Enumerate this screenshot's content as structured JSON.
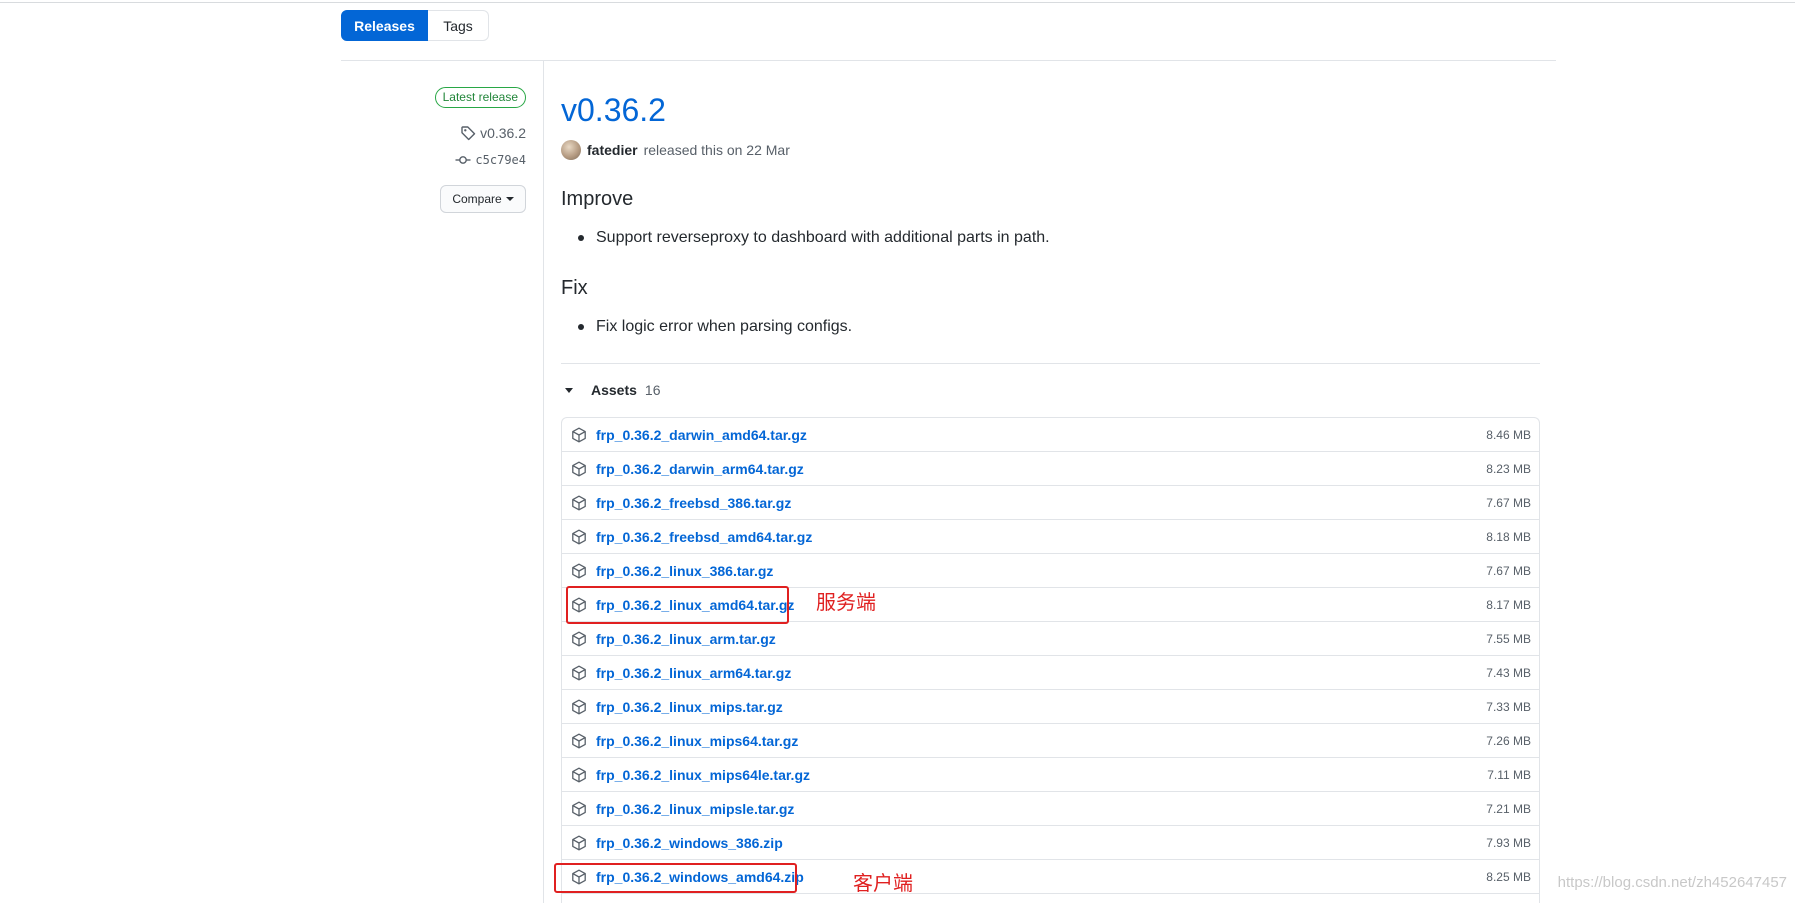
{
  "tabs": [
    {
      "label": "Releases",
      "active": true
    },
    {
      "label": "Tags",
      "active": false
    }
  ],
  "sidebar": {
    "latest_badge": "Latest release",
    "tag": "v0.36.2",
    "commit": "c5c79e4",
    "compare_label": "Compare"
  },
  "release": {
    "title": "v0.36.2",
    "author": "fatedier",
    "released_text": "released this on 22 Mar",
    "sections": [
      {
        "heading": "Improve",
        "items": [
          "Support reverseproxy to dashboard with additional parts in path."
        ]
      },
      {
        "heading": "Fix",
        "items": [
          "Fix logic error when parsing configs."
        ]
      }
    ]
  },
  "assets": {
    "label": "Assets",
    "count": "16",
    "items": [
      {
        "name": "frp_0.36.2_darwin_amd64.tar.gz",
        "size": "8.46 MB"
      },
      {
        "name": "frp_0.36.2_darwin_arm64.tar.gz",
        "size": "8.23 MB"
      },
      {
        "name": "frp_0.36.2_freebsd_386.tar.gz",
        "size": "7.67 MB"
      },
      {
        "name": "frp_0.36.2_freebsd_amd64.tar.gz",
        "size": "8.18 MB"
      },
      {
        "name": "frp_0.36.2_linux_386.tar.gz",
        "size": "7.67 MB"
      },
      {
        "name": "frp_0.36.2_linux_amd64.tar.gz",
        "size": "8.17 MB"
      },
      {
        "name": "frp_0.36.2_linux_arm.tar.gz",
        "size": "7.55 MB"
      },
      {
        "name": "frp_0.36.2_linux_arm64.tar.gz",
        "size": "7.43 MB"
      },
      {
        "name": "frp_0.36.2_linux_mips.tar.gz",
        "size": "7.33 MB"
      },
      {
        "name": "frp_0.36.2_linux_mips64.tar.gz",
        "size": "7.26 MB"
      },
      {
        "name": "frp_0.36.2_linux_mips64le.tar.gz",
        "size": "7.11 MB"
      },
      {
        "name": "frp_0.36.2_linux_mipsle.tar.gz",
        "size": "7.21 MB"
      },
      {
        "name": "frp_0.36.2_windows_386.zip",
        "size": "7.93 MB"
      },
      {
        "name": "frp_0.36.2_windows_amd64.zip",
        "size": "8.25 MB"
      }
    ]
  },
  "annotations": {
    "server_label": "服务端",
    "client_label": "客户端"
  },
  "watermark": "https://blog.csdn.net/zh452647457",
  "colors": {
    "accent": "#0366d6",
    "badge_green": "#28a745",
    "annotation_red": "#e02020"
  }
}
